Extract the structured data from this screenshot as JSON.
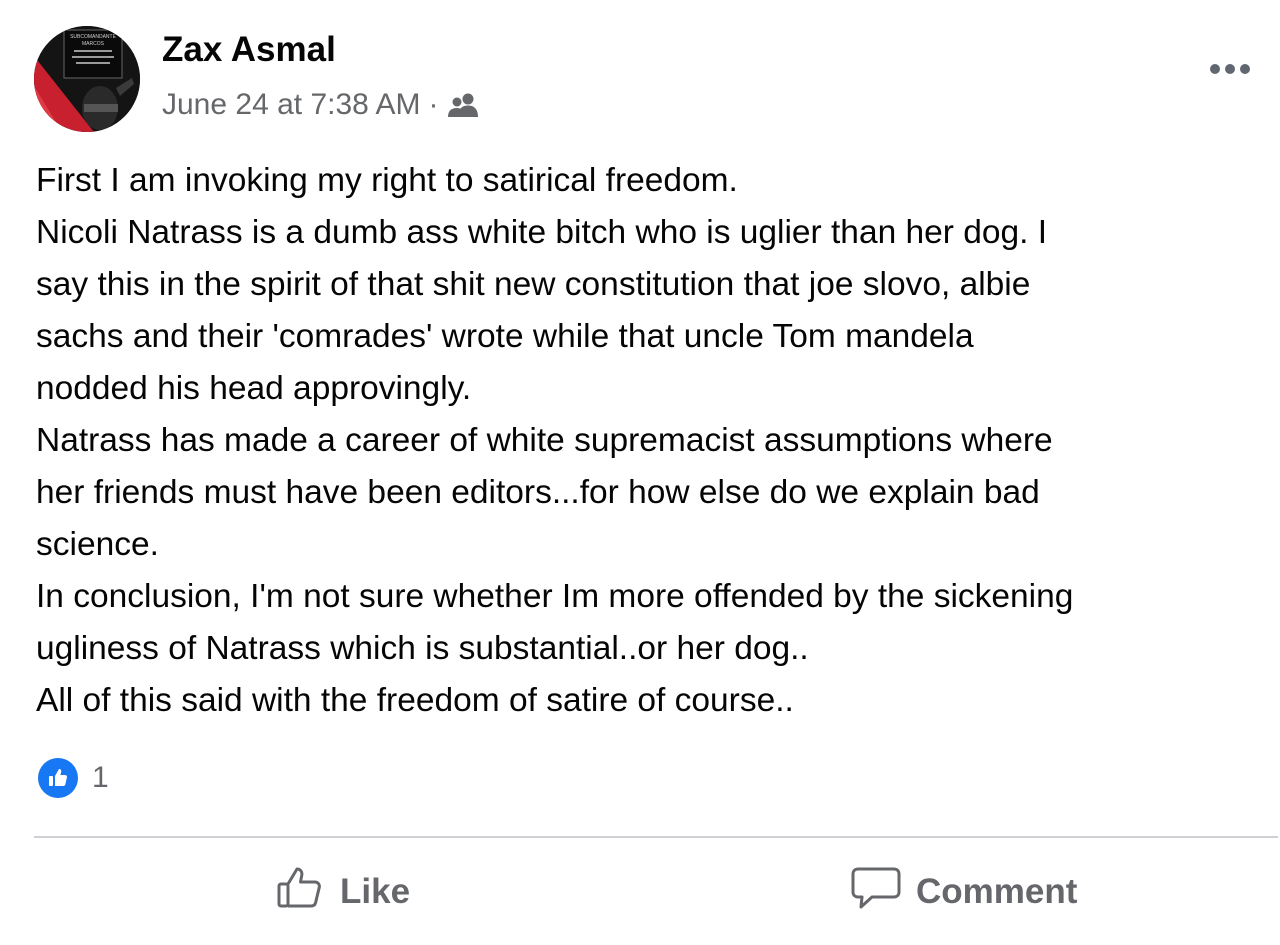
{
  "post": {
    "author": "Zax Asmal",
    "timestamp": "June 24 at 7:38 AM",
    "separator": "·",
    "audience_icon": "friends-icon",
    "body": [
      "First I am invoking my right to satirical freedom.",
      "Nicoli Natrass is a dumb ass white bitch who is uglier than her dog. I",
      "say this in the spirit of that shit new constitution that joe slovo, albie",
      "sachs and their 'comrades' wrote while that uncle Tom mandela",
      "nodded his head approvingly.",
      "Natrass has made a career of white supremacist assumptions where",
      "her friends must have been editors...for how else do we explain bad",
      "science.",
      "In conclusion, I'm not sure whether Im more offended by the sickening",
      "ugliness of Natrass which is substantial..or her dog..",
      "All of this said with the freedom of satire of course.."
    ],
    "avatar_text": [
      "SUBCOMANDANTE",
      "MARCOS"
    ]
  },
  "reactions": {
    "icon": "thumbs-up-icon",
    "count": "1"
  },
  "actions": {
    "like_label": "Like",
    "comment_label": "Comment"
  },
  "colors": {
    "accent": "#1877f2",
    "secondary_text": "#65676b",
    "divider": "#ced0d4"
  }
}
